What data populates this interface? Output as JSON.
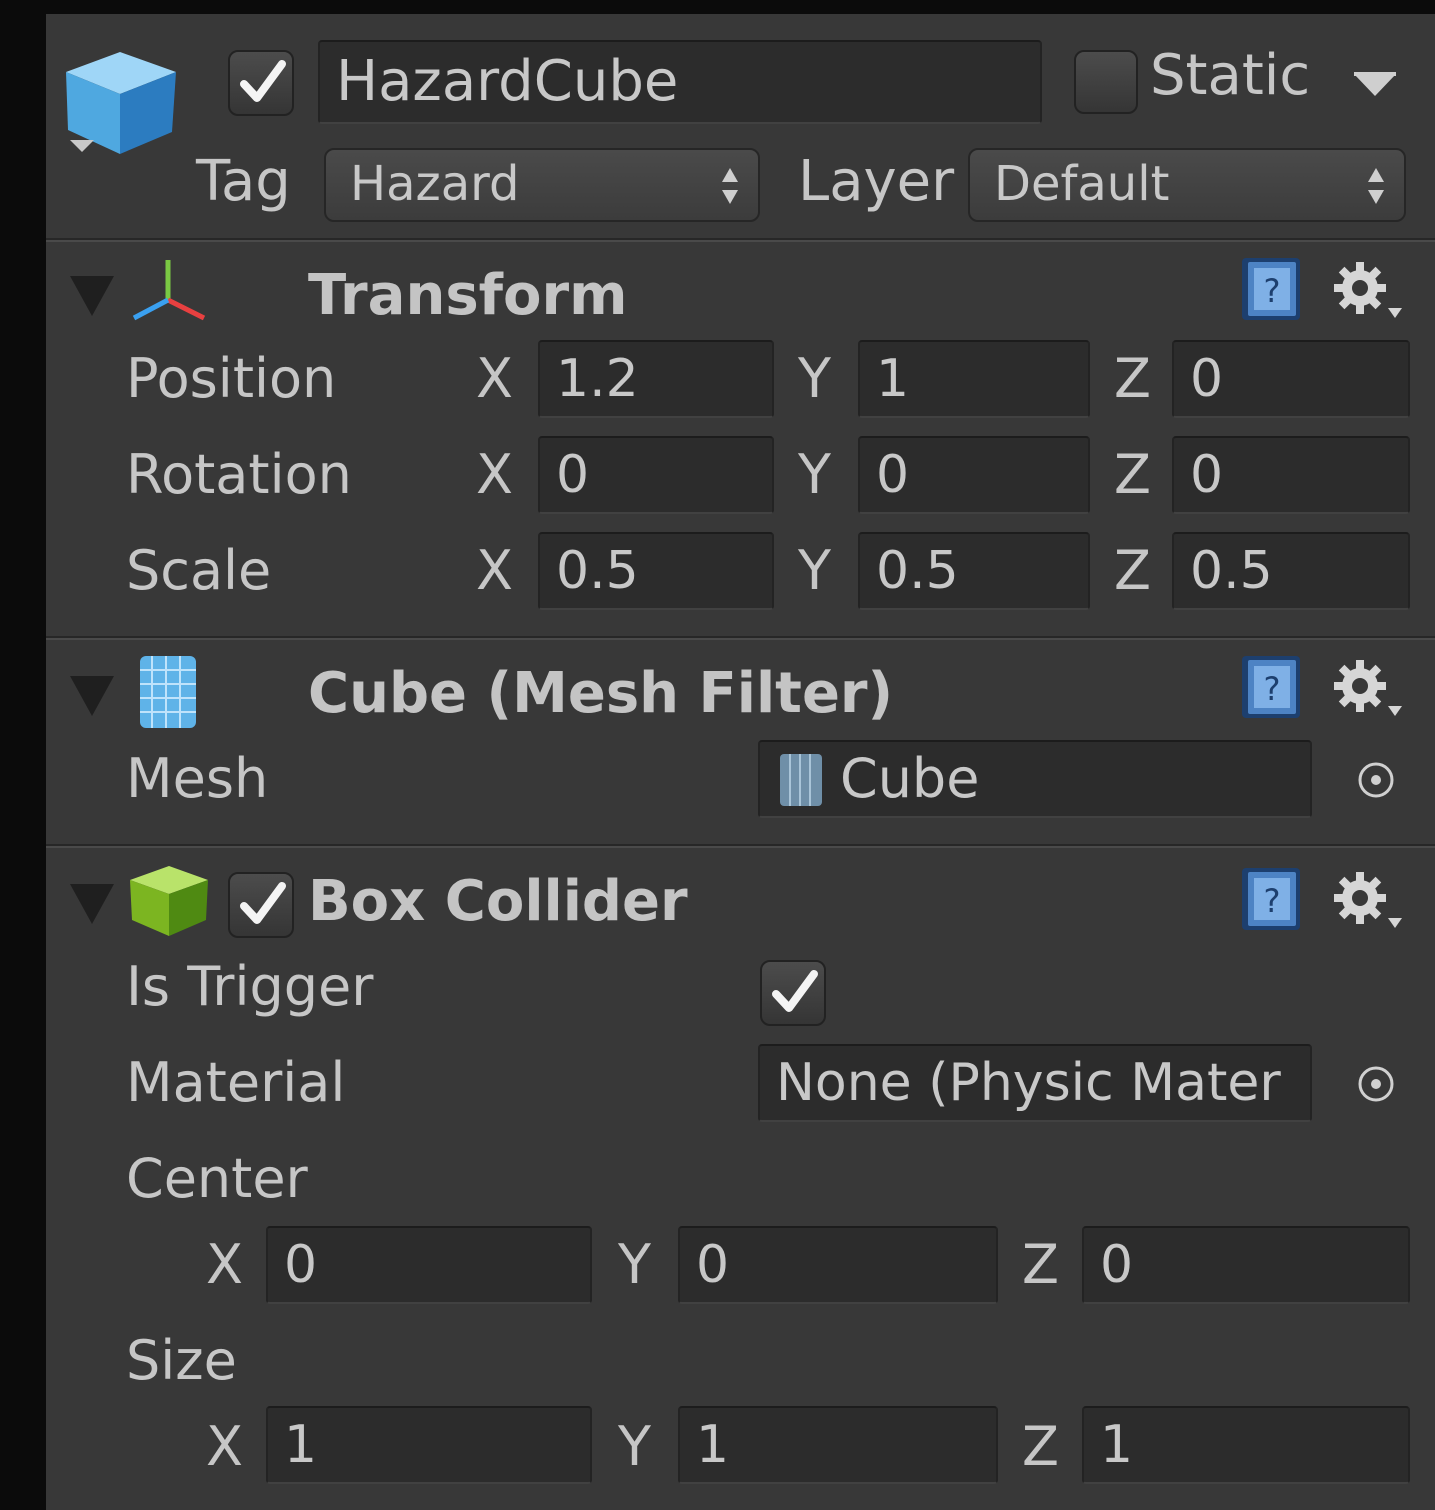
{
  "header": {
    "active": true,
    "name": "HazardCube",
    "static_label": "Static",
    "static_checked": false,
    "tag_label": "Tag",
    "tag_value": "Hazard",
    "layer_label": "Layer",
    "layer_value": "Default"
  },
  "transform": {
    "title": "Transform",
    "position": {
      "label": "Position",
      "x": "1.2",
      "y": "1",
      "z": "0"
    },
    "rotation": {
      "label": "Rotation",
      "x": "0",
      "y": "0",
      "z": "0"
    },
    "scale": {
      "label": "Scale",
      "x": "0.5",
      "y": "0.5",
      "z": "0.5"
    }
  },
  "mesh_filter": {
    "title": "Cube (Mesh Filter)",
    "mesh_label": "Mesh",
    "mesh_value": "Cube"
  },
  "box_collider": {
    "title": "Box Collider",
    "enabled": true,
    "is_trigger_label": "Is Trigger",
    "is_trigger": true,
    "material_label": "Material",
    "material_value": "None (Physic Mater",
    "center": {
      "label": "Center",
      "x": "0",
      "y": "0",
      "z": "0"
    },
    "size": {
      "label": "Size",
      "x": "1",
      "y": "1",
      "z": "1"
    }
  },
  "axes": {
    "x": "X",
    "y": "Y",
    "z": "Z"
  },
  "colors": {
    "panel_bg": "#383838",
    "field_bg": "#2c2c2c",
    "text": "#c8c8c8",
    "cube_blue": "#4fa8e0",
    "cube_green": "#7cb521"
  },
  "icons": [
    "gameobject-cube-icon",
    "transform-axes-icon",
    "mesh-filter-icon",
    "box-collider-icon",
    "help-book-icon",
    "gear-icon",
    "object-picker-icon",
    "fold-arrow-icon",
    "checkmark-icon"
  ]
}
